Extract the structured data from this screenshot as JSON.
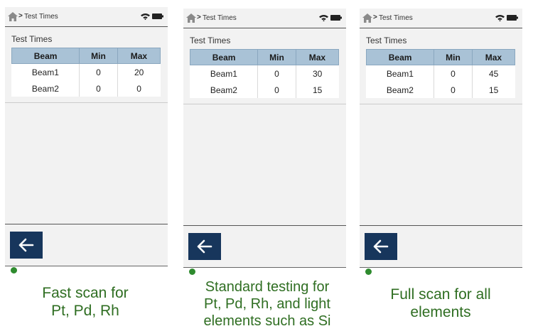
{
  "colors": {
    "header_bg": "#a9c2d6",
    "button_bg": "#17365c",
    "status_dot": "#2e8b2e",
    "caption_text": "#2f6e22"
  },
  "screens": [
    {
      "breadcrumb": "Test Times",
      "title": "Test Times",
      "columns": [
        "Beam",
        "Min",
        "Max"
      ],
      "rows": [
        [
          "Beam1",
          "0",
          "20"
        ],
        [
          "Beam2",
          "0",
          "0"
        ]
      ],
      "caption": [
        "Fast scan for",
        "Pt, Pd, Rh"
      ]
    },
    {
      "breadcrumb": "Test Times",
      "title": "Test Times",
      "columns": [
        "Beam",
        "Min",
        "Max"
      ],
      "rows": [
        [
          "Beam1",
          "0",
          "30"
        ],
        [
          "Beam2",
          "0",
          "15"
        ]
      ],
      "caption": [
        "Standard testing for",
        "Pt, Pd, Rh, and light",
        "elements such as Si"
      ]
    },
    {
      "breadcrumb": "Test Times",
      "title": "Test Times",
      "columns": [
        "Beam",
        "Min",
        "Max"
      ],
      "rows": [
        [
          "Beam1",
          "0",
          "45"
        ],
        [
          "Beam2",
          "0",
          "15"
        ]
      ],
      "caption": [
        "Full scan for all",
        "elements"
      ]
    }
  ]
}
